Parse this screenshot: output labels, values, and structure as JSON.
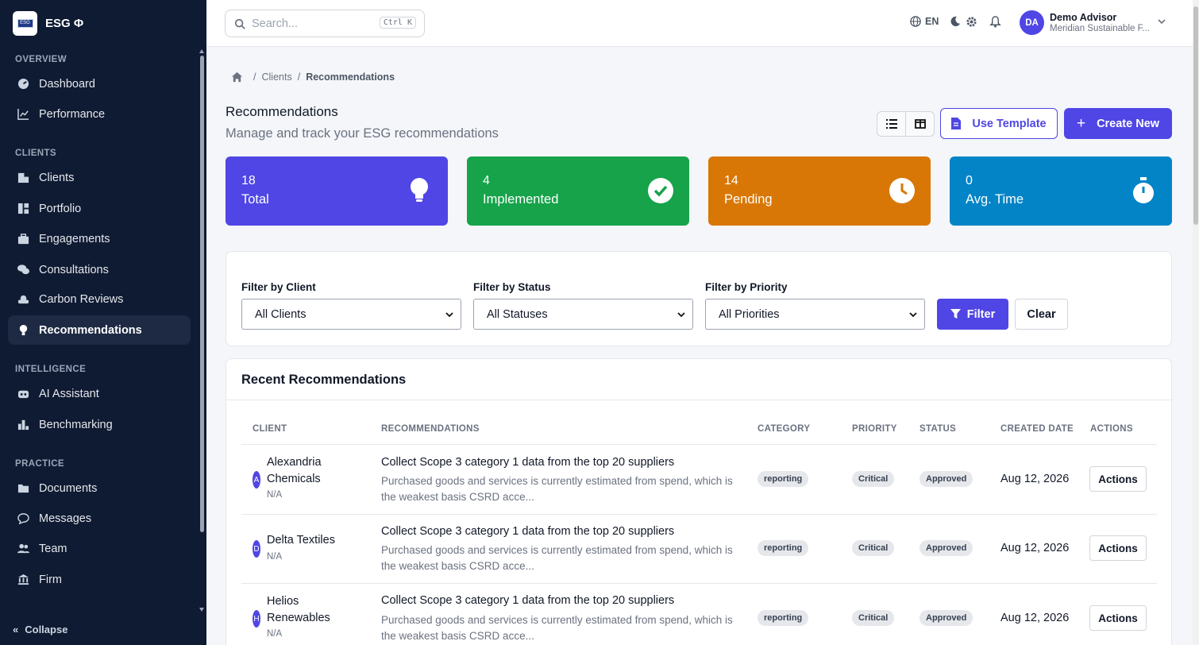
{
  "app": {
    "name": "ESG Φ",
    "logo_text": "ESG"
  },
  "sidebar": {
    "sections": [
      {
        "title": "OVERVIEW"
      },
      {
        "title": "CLIENTS"
      },
      {
        "title": "INTELLIGENCE"
      },
      {
        "title": "PRACTICE"
      }
    ],
    "items": [
      {
        "label": "Dashboard",
        "icon": "gauge-icon"
      },
      {
        "label": "Performance",
        "icon": "chart-line-icon"
      },
      {
        "label": "Clients",
        "icon": "building-icon"
      },
      {
        "label": "Portfolio",
        "icon": "portfolio-icon"
      },
      {
        "label": "Engagements",
        "icon": "briefcase-icon"
      },
      {
        "label": "Consultations",
        "icon": "comments-icon"
      },
      {
        "label": "Carbon Reviews",
        "icon": "cloud-icon"
      },
      {
        "label": "Recommendations",
        "icon": "lightbulb-icon",
        "active": true
      },
      {
        "label": "AI Assistant",
        "icon": "robot-icon"
      },
      {
        "label": "Benchmarking",
        "icon": "ranking-icon"
      },
      {
        "label": "Documents",
        "icon": "folder-icon"
      },
      {
        "label": "Messages",
        "icon": "bubble-icon"
      },
      {
        "label": "Team",
        "icon": "users-icon"
      },
      {
        "label": "Firm",
        "icon": "bank-icon"
      }
    ],
    "collapse_label": "Collapse"
  },
  "topbar": {
    "search_placeholder": "Search...",
    "search_shortcut": "Ctrl K",
    "language": "EN",
    "user": {
      "initials": "DA",
      "name": "Demo Advisor",
      "org": "Meridian Sustainable F..."
    }
  },
  "breadcrumb": {
    "items": [
      "Clients",
      "Recommendations"
    ]
  },
  "page": {
    "title": "Recommendations",
    "subtitle": "Manage and track your ESG recommendations",
    "use_template_label": "Use Template",
    "create_new_label": "Create New"
  },
  "stats": [
    {
      "value": "18",
      "label": "Total",
      "color": "#4f46e5",
      "icon": "lightbulb-icon"
    },
    {
      "value": "4",
      "label": "Implemented",
      "color": "#16a34a",
      "icon": "check-circle-icon"
    },
    {
      "value": "14",
      "label": "Pending",
      "color": "#d97706",
      "icon": "clock-icon"
    },
    {
      "value": "0",
      "label": "Avg. Time",
      "color": "#0284c7",
      "icon": "stopwatch-icon"
    }
  ],
  "filters": {
    "client_label": "Filter by Client",
    "client_value": "All Clients",
    "status_label": "Filter by Status",
    "status_value": "All Statuses",
    "priority_label": "Filter by Priority",
    "priority_value": "All Priorities",
    "filter_button": "Filter",
    "clear_button": "Clear"
  },
  "table": {
    "title": "Recent Recommendations",
    "columns": [
      "CLIENT",
      "RECOMMENDATIONS",
      "CATEGORY",
      "PRIORITY",
      "STATUS",
      "CREATED DATE",
      "ACTIONS"
    ],
    "rows": [
      {
        "initial": "A",
        "client": "Alexandria Chemicals",
        "sub": "N/A",
        "title": "Collect Scope 3 category 1 data from the top 20 suppliers",
        "desc": "Purchased goods and services is currently estimated from spend, which is the weakest basis CSRD acce...",
        "category": "reporting",
        "priority": "Critical",
        "status": "Approved",
        "date": "Aug 12, 2026",
        "action": "Actions"
      },
      {
        "initial": "D",
        "client": "Delta Textiles",
        "sub": "N/A",
        "title": "Collect Scope 3 category 1 data from the top 20 suppliers",
        "desc": "Purchased goods and services is currently estimated from spend, which is the weakest basis CSRD acce...",
        "category": "reporting",
        "priority": "Critical",
        "status": "Approved",
        "date": "Aug 12, 2026",
        "action": "Actions"
      },
      {
        "initial": "H",
        "client": "Helios Renewables",
        "sub": "N/A",
        "title": "Collect Scope 3 category 1 data from the top 20 suppliers",
        "desc": "Purchased goods and services is currently estimated from spend, which is the weakest basis CSRD acce...",
        "category": "reporting",
        "priority": "Critical",
        "status": "Approved",
        "date": "Aug 12, 2026",
        "action": "Actions"
      }
    ]
  }
}
